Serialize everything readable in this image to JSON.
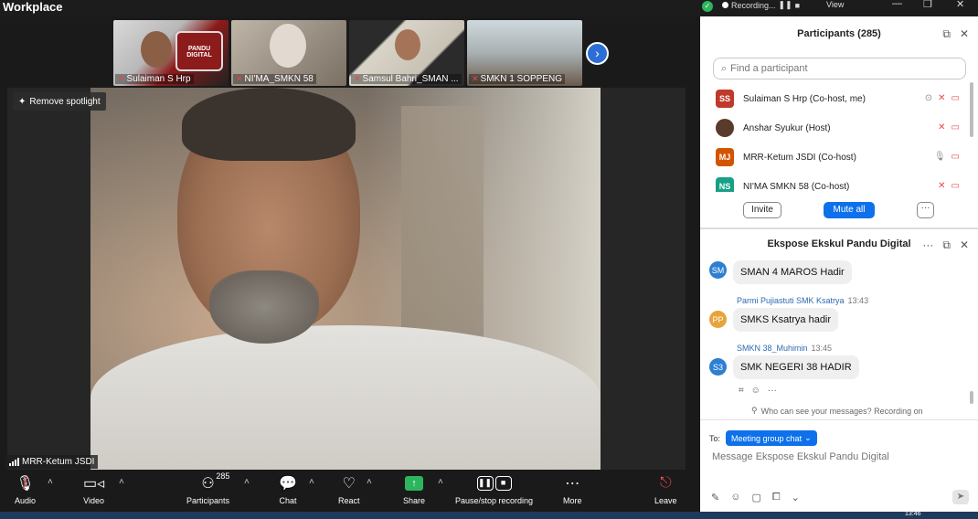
{
  "app": {
    "title": "Workplace"
  },
  "top_right": {
    "recording": "Recording...",
    "view": "View"
  },
  "thumbnails": [
    {
      "name": "Sulaiman S Hrp",
      "badge": "PANDU DIGITAL"
    },
    {
      "name": "NI'MA_SMKN 58"
    },
    {
      "name": "Samsul Bahri_SMAN ..."
    },
    {
      "name": "SMKN 1 SOPPENG"
    }
  ],
  "spotlight": {
    "remove_label": "Remove spotlight",
    "speaker": "MRR-Ketum JSDI"
  },
  "toolbar": {
    "audio": "Audio",
    "video": "Video",
    "participants": "Participants",
    "participants_count": "285",
    "chat": "Chat",
    "react": "React",
    "share": "Share",
    "record": "Pause/stop recording",
    "more": "More",
    "leave": "Leave"
  },
  "participants_panel": {
    "title": "Participants (285)",
    "search_placeholder": "Find a participant",
    "rows": [
      {
        "initials": "SS",
        "name": "Sulaiman S Hrp (Co-host, me)",
        "color": "#c0392b"
      },
      {
        "initials": "",
        "name": "Anshar Syukur (Host)",
        "color": "#5a3a2a"
      },
      {
        "initials": "MJ",
        "name": "MRR-Ketum JSDI (Co-host)",
        "color": "#d35400"
      },
      {
        "initials": "NS",
        "name": "NI'MA SMKN 58 (Co-host)",
        "color": "#16a085"
      }
    ],
    "invite": "Invite",
    "mute_all": "Mute all",
    "more": "···"
  },
  "chat_panel": {
    "title": "Ekspose Ekskul Pandu Digital",
    "messages": [
      {
        "initials": "SM",
        "color": "#2d7fd1",
        "sender": "",
        "time": "",
        "text": "SMAN 4 MAROS Hadir"
      },
      {
        "initials": "PP",
        "color": "#e8a33a",
        "sender": "Parmi Pujiastuti SMK Ksatrya",
        "time": "13:43",
        "text": "SMKS Ksatrya hadir"
      },
      {
        "initials": "S3",
        "color": "#2d7fd1",
        "sender": "SMKN 38_Muhimin",
        "time": "13:45",
        "text": "SMK NEGERI 38 HADIR"
      }
    ],
    "who_can_see": "Who can see your messages? Recording on",
    "to_label": "To:",
    "to_target": "Meeting group chat",
    "input_placeholder": "Message Ekspose Ekskul Pandu Digital"
  },
  "taskbar": {
    "clock": "13:46"
  },
  "colors": {
    "accent": "#0e71eb",
    "share_green": "#2db55d",
    "muted_red": "#e5484d"
  }
}
